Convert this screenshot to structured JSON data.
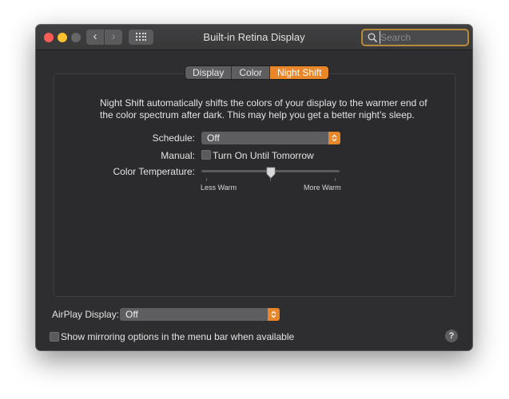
{
  "window": {
    "title": "Built-in Retina Display"
  },
  "toolbar": {
    "back_label": "‹",
    "forward_label": "›",
    "search_placeholder": "Search"
  },
  "tabs": [
    {
      "label": "Display",
      "active": false
    },
    {
      "label": "Color",
      "active": false
    },
    {
      "label": "Night Shift",
      "active": true
    }
  ],
  "night_shift": {
    "description": "Night Shift automatically shifts the colors of your display to the warmer end of the color spectrum after dark. This may help you get a better night’s sleep.",
    "schedule_label": "Schedule:",
    "schedule_value": "Off",
    "manual_label": "Manual:",
    "manual_checkbox_label": "Turn On Until Tomorrow",
    "manual_checked": false,
    "temperature_label": "Color Temperature:",
    "temperature_level": 0.5,
    "less_warm_label": "Less Warm",
    "more_warm_label": "More Warm"
  },
  "airplay": {
    "label": "AirPlay Display:",
    "value": "Off"
  },
  "mirroring": {
    "checkbox_label": "Show mirroring options in the menu bar when available",
    "checked": false
  },
  "help_label": "?",
  "colors": {
    "accent": "#e8862a",
    "window_bg": "#2e2e30",
    "focus_ring": "#b58a38"
  },
  "icons": {
    "search": "magnifier-icon",
    "grid": "show-all-grid-icon",
    "popup": "chevron-updown-icon"
  }
}
